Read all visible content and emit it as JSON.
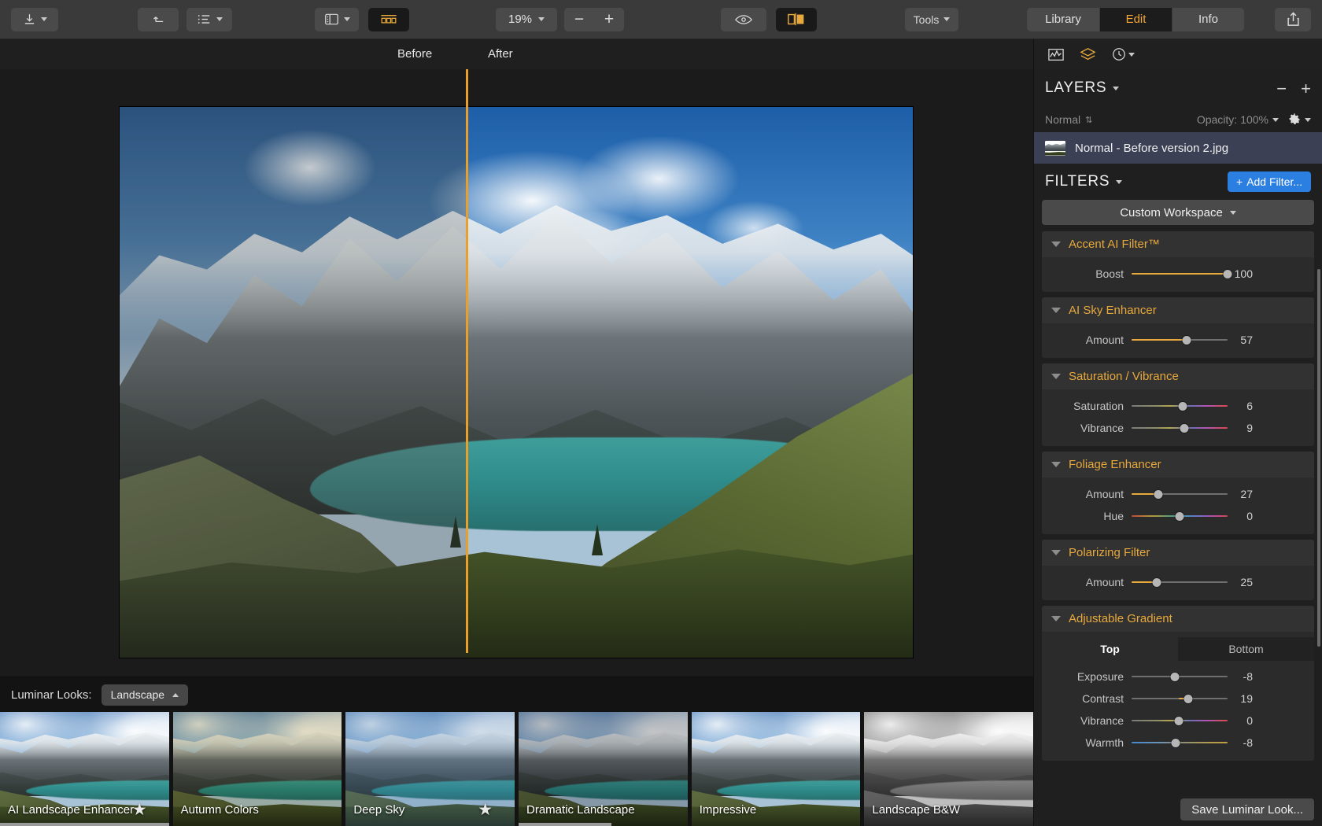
{
  "toolbar": {
    "export_icon": "download-icon",
    "undo_icon": "undo-arrow-icon",
    "list_icon": "list-view-icon",
    "sidepanel_icon": "side-panel-icon",
    "filmstrip_icon": "filmstrip-icon",
    "zoom_value": "19%",
    "zoom_out_label": "−",
    "zoom_in_label": "+",
    "eye_icon": "eye-icon",
    "compare_icon": "before-after-compare-icon",
    "tools_label": "Tools",
    "share_icon": "share-icon",
    "tabs": [
      {
        "label": "Library",
        "active": false
      },
      {
        "label": "Edit",
        "active": true
      },
      {
        "label": "Info",
        "active": false
      }
    ]
  },
  "canvas": {
    "before_label": "Before",
    "after_label": "After"
  },
  "right_panel": {
    "icons": [
      {
        "name": "histogram-icon"
      },
      {
        "name": "layers-icon"
      },
      {
        "name": "history-clock-icon"
      }
    ],
    "layers": {
      "title": "LAYERS",
      "minus_label": "−",
      "plus_label": "+",
      "blend_mode": "Normal",
      "opacity_label": "Opacity:",
      "opacity_value": "100%",
      "gear_icon": "gear-icon",
      "items": [
        {
          "name": "Normal - Before version 2.jpg",
          "selected": true
        }
      ]
    },
    "filters": {
      "title": "FILTERS",
      "add_filter_label": "Add Filter...",
      "add_filter_plus": "+",
      "workspace": "Custom Workspace",
      "groups": [
        {
          "title": "Accent AI Filter™",
          "expanded": true,
          "sliders": [
            {
              "label": "Boost",
              "value": "100",
              "pct": 100,
              "style": "fill"
            }
          ]
        },
        {
          "title": "AI Sky Enhancer",
          "expanded": true,
          "sliders": [
            {
              "label": "Amount",
              "value": "57",
              "pct": 57,
              "style": "fill"
            }
          ]
        },
        {
          "title": "Saturation / Vibrance",
          "expanded": true,
          "sliders": [
            {
              "label": "Saturation",
              "value": "6",
              "pct": 53,
              "style": "gradient"
            },
            {
              "label": "Vibrance",
              "value": "9",
              "pct": 55,
              "style": "gradient"
            }
          ]
        },
        {
          "title": "Foliage Enhancer",
          "expanded": true,
          "sliders": [
            {
              "label": "Amount",
              "value": "27",
              "pct": 28,
              "style": "fill"
            },
            {
              "label": "Hue",
              "value": "0",
              "pct": 50,
              "style": "hue"
            }
          ]
        },
        {
          "title": "Polarizing Filter",
          "expanded": true,
          "sliders": [
            {
              "label": "Amount",
              "value": "25",
              "pct": 26,
              "style": "fill"
            }
          ]
        },
        {
          "title": "Adjustable Gradient",
          "expanded": true,
          "tabs": [
            {
              "label": "Top",
              "active": true
            },
            {
              "label": "Bottom",
              "active": false
            }
          ],
          "sliders": [
            {
              "label": "Exposure",
              "value": "-8",
              "pct": 45,
              "style": "plain"
            },
            {
              "label": "Contrast",
              "value": "19",
              "pct": 59,
              "style": "center-fill"
            },
            {
              "label": "Vibrance",
              "value": "0",
              "pct": 49,
              "style": "gradient"
            },
            {
              "label": "Warmth",
              "value": "-8",
              "pct": 46,
              "style": "warm"
            }
          ]
        }
      ]
    },
    "save_look_label": "Save Luminar Look..."
  },
  "looks": {
    "label": "Luminar Looks:",
    "category": "Landscape",
    "items": [
      {
        "name": "AI Landscape Enhancer",
        "starred": true,
        "tint": "none",
        "progress": 100
      },
      {
        "name": "Autumn Colors",
        "starred": false,
        "tint": "warm",
        "progress": 0
      },
      {
        "name": "Deep Sky",
        "starred": true,
        "tint": "cool",
        "progress": 0
      },
      {
        "name": "Dramatic Landscape",
        "starred": false,
        "tint": "dark",
        "progress": 55
      },
      {
        "name": "Impressive",
        "starred": false,
        "tint": "none",
        "progress": 0
      },
      {
        "name": "Landscape B&W",
        "starred": false,
        "tint": "bw",
        "progress": 0
      }
    ]
  },
  "colors": {
    "accent": "#e8a93c",
    "blue": "#2b7fe0",
    "panel": "#1f1f1f",
    "toolbar": "#3a3a3a"
  }
}
